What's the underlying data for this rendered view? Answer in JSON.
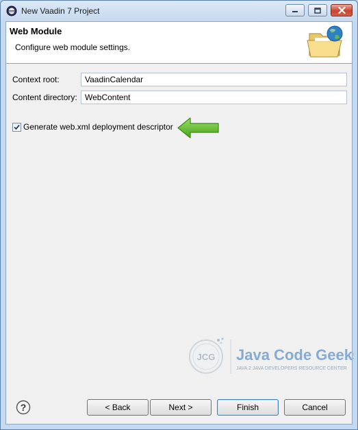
{
  "window": {
    "title": "New Vaadin 7 Project"
  },
  "banner": {
    "title": "Web Module",
    "description": "Configure web module settings."
  },
  "form": {
    "context_root_label": "Context root:",
    "context_root_value": "VaadinCalendar",
    "content_dir_label": "Content directory:",
    "content_dir_value": "WebContent",
    "generate_descriptor_label": "Generate web.xml deployment descriptor",
    "generate_descriptor_checked": true
  },
  "watermark": {
    "logo_text": "JCG",
    "brand": "Java Code Geeks",
    "tagline": "JAVA 2 JAVA DEVELOPERS RESOURCE CENTER"
  },
  "buttons": {
    "back": "< Back",
    "next": "Next >",
    "finish": "Finish",
    "cancel": "Cancel"
  },
  "colors": {
    "arrow_green": "#5cb82a",
    "watermark_blue": "#5a8fc4"
  }
}
